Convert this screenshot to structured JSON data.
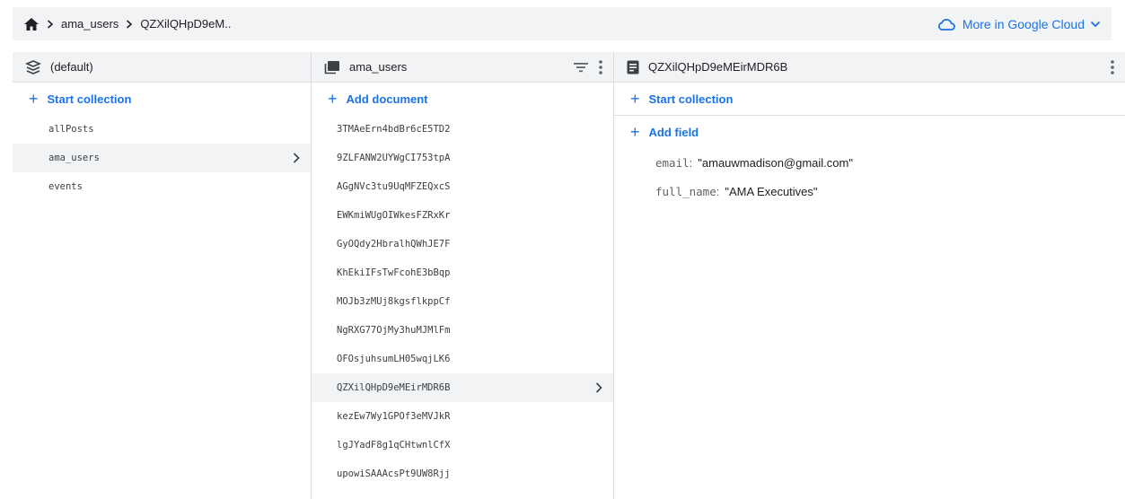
{
  "breadcrumb": {
    "items": [
      "ama_users",
      "QZXilQHpD9eM.."
    ],
    "cloud_link": "More in Google Cloud"
  },
  "database_panel": {
    "title": "(default)",
    "add_label": "Start collection",
    "collections": [
      "allPosts",
      "ama_users",
      "events"
    ],
    "selected": "ama_users"
  },
  "collection_panel": {
    "title": "ama_users",
    "add_label": "Add document",
    "documents": [
      "3TMAeErn4bdBr6cE5TD2",
      "9ZLFANW2UYWgCI753tpA",
      "AGgNVc3tu9UqMFZEQxcS",
      "EWKmiWUgOIWkesFZRxKr",
      "GyOQdy2HbralhQWhJE7F",
      "KhEkiIFsTwFcohE3bBqp",
      "MOJb3zMUj8kgsflkppCf",
      "NgRXG77OjMy3huMJMlFm",
      "OFOsjuhsumLH05wqjLK6",
      "QZXilQHpD9eMEirMDR6B",
      "kezEw7Wy1GPOf3eMVJkR",
      "lgJYadF8g1qCHtwnlCfX",
      "upowiSAAAcsPt9UW8Rjj"
    ],
    "selected": "QZXilQHpD9eMEirMDR6B"
  },
  "document_panel": {
    "title": "QZXilQHpD9eMEirMDR6B",
    "start_collection_label": "Start collection",
    "add_field_label": "Add field",
    "fields": [
      {
        "key": "email",
        "value": "\"amauwmadison@gmail.com\""
      },
      {
        "key": "full_name",
        "value": "\"AMA Executives\""
      }
    ]
  },
  "colors": {
    "accent": "#1a73e8",
    "header_bg": "#f1f3f4",
    "selected_bg": "#f1f3f4"
  },
  "icons": {
    "home": "home-icon",
    "database": "database-icon",
    "collection": "collection-icon",
    "document": "document-icon",
    "cloud": "cloud-icon",
    "filter": "filter-icon",
    "more": "more-vert-icon"
  }
}
